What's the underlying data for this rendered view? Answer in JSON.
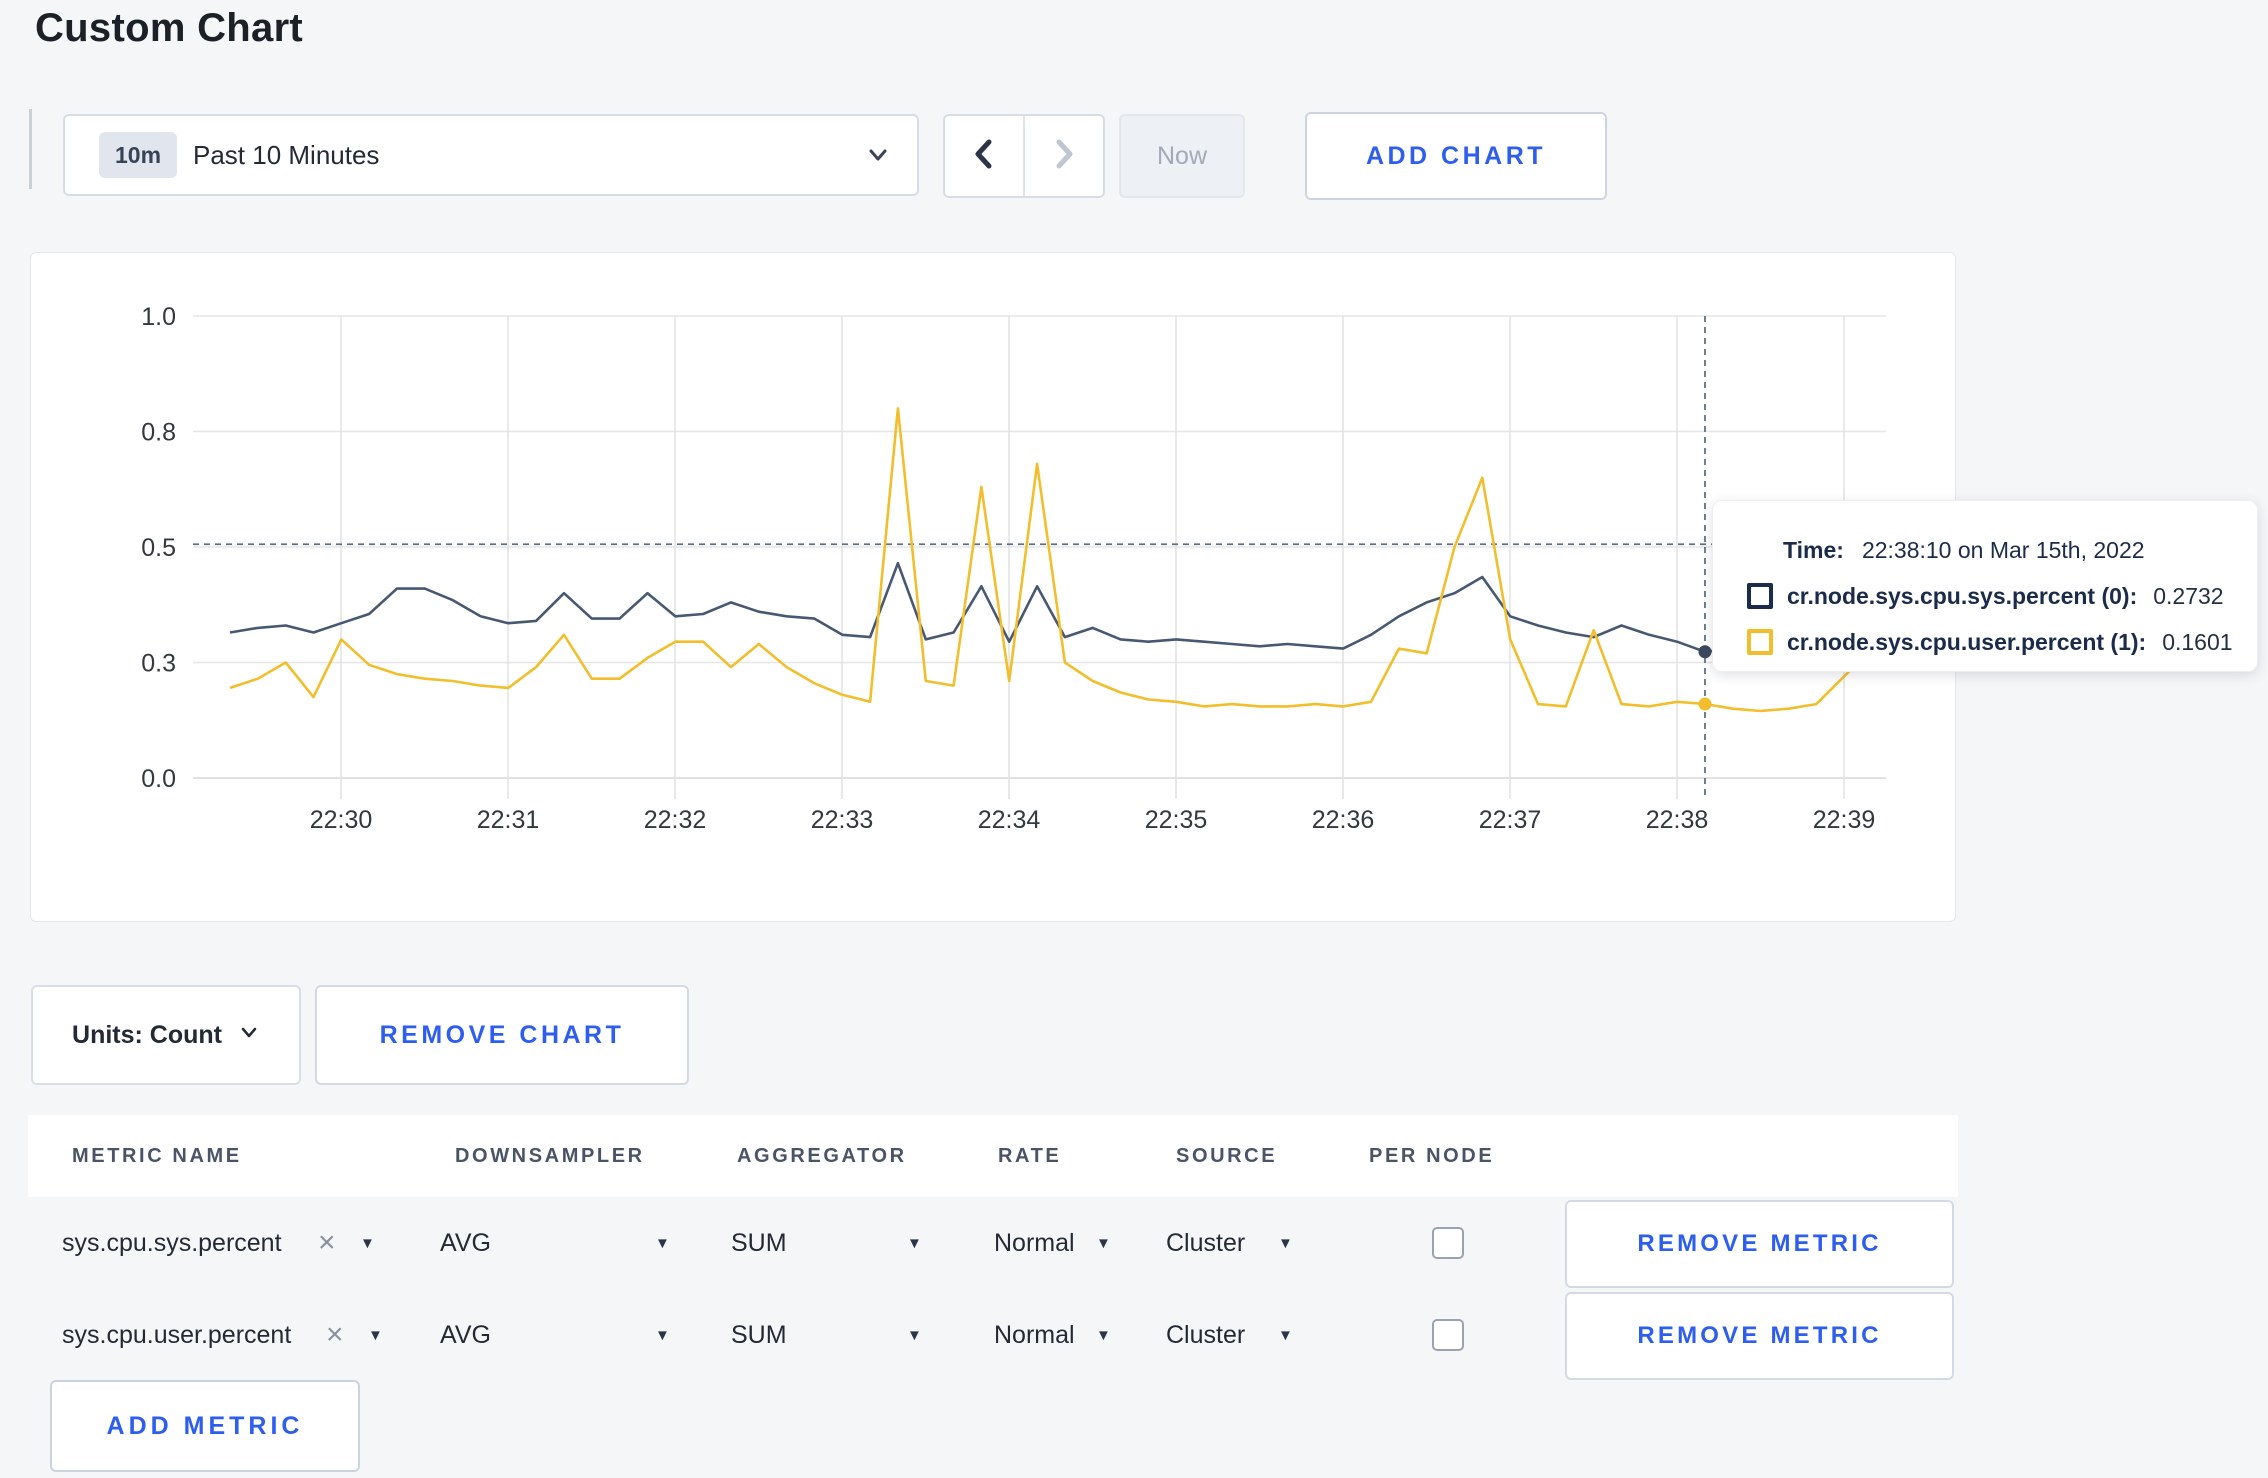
{
  "page": {
    "title": "Custom Chart",
    "background": "#f5f6f8",
    "accent_blue": "#2e5ef0"
  },
  "toolbar": {
    "time_select": {
      "badge": "10m",
      "label": "Past 10 Minutes"
    },
    "now_button": "Now",
    "add_chart_button": "ADD CHART"
  },
  "chart_data": {
    "type": "line",
    "title": "",
    "xlabel": "",
    "ylabel": "",
    "y_range": [
      0,
      1
    ],
    "grid": true,
    "y_tick_labels_bottom_up": [
      "0.0",
      "0.3",
      "0.5",
      "0.8",
      "1.0"
    ],
    "x_tick_labels": [
      "22:30",
      "22:31",
      "22:32",
      "22:33",
      "22:34",
      "22:35",
      "22:36",
      "22:37",
      "22:38",
      "22:39"
    ],
    "start_time": "22:29:20",
    "interval_seconds": 10,
    "series": [
      {
        "name": "cr.node.sys.cpu.sys.percent",
        "color": "#475872",
        "values": [
          0.315,
          0.325,
          0.33,
          0.315,
          0.335,
          0.355,
          0.41,
          0.41,
          0.385,
          0.35,
          0.335,
          0.34,
          0.4,
          0.345,
          0.345,
          0.4,
          0.35,
          0.355,
          0.38,
          0.36,
          0.35,
          0.345,
          0.31,
          0.305,
          0.465,
          0.3,
          0.315,
          0.415,
          0.295,
          0.415,
          0.305,
          0.325,
          0.3,
          0.295,
          0.3,
          0.295,
          0.29,
          0.285,
          0.29,
          0.285,
          0.28,
          0.31,
          0.35,
          0.38,
          0.4,
          0.435,
          0.35,
          0.33,
          0.315,
          0.305,
          0.33,
          0.31,
          0.295,
          0.2732,
          0.28,
          0.29,
          0.3,
          0.305,
          0.3,
          0.31,
          0.305
        ]
      },
      {
        "name": "cr.node.sys.cpu.user.percent",
        "color": "#F2BE2C",
        "values": [
          0.195,
          0.215,
          0.25,
          0.175,
          0.3,
          0.245,
          0.225,
          0.215,
          0.21,
          0.2,
          0.195,
          0.24,
          0.31,
          0.215,
          0.215,
          0.26,
          0.295,
          0.295,
          0.24,
          0.29,
          0.24,
          0.205,
          0.18,
          0.165,
          0.8,
          0.21,
          0.2,
          0.63,
          0.21,
          0.68,
          0.25,
          0.21,
          0.185,
          0.17,
          0.165,
          0.155,
          0.16,
          0.155,
          0.155,
          0.16,
          0.155,
          0.165,
          0.28,
          0.27,
          0.5,
          0.65,
          0.3,
          0.16,
          0.155,
          0.32,
          0.16,
          0.155,
          0.165,
          0.1601,
          0.15,
          0.145,
          0.15,
          0.16,
          0.22,
          0.28,
          0.25
        ]
      }
    ],
    "crosshair": {
      "time": "22:38:10",
      "x_index": 53,
      "y_value": 0.506
    },
    "legend_position": "tooltip"
  },
  "tooltip": {
    "time_label": "Time:",
    "time_value": "22:38:10 on Mar 15th, 2022",
    "rows": [
      {
        "name": "cr.node.sys.cpu.sys.percent (0):",
        "value": "0.2732",
        "color": "#1b2b4a"
      },
      {
        "name": "cr.node.sys.cpu.user.percent (1):",
        "value": "0.1601",
        "color": "#F2BE2C"
      }
    ]
  },
  "chart_controls": {
    "units_button": "Units: Count",
    "remove_chart_button": "REMOVE CHART"
  },
  "metrics_table": {
    "headers": [
      "METRIC NAME",
      "DOWNSAMPLER",
      "AGGREGATOR",
      "RATE",
      "SOURCE",
      "PER NODE"
    ],
    "rows": [
      {
        "name": "sys.cpu.sys.percent",
        "downsampler": "AVG",
        "aggregator": "SUM",
        "rate": "Normal",
        "source": "Cluster",
        "per_node_checked": false,
        "remove_button": "REMOVE METRIC"
      },
      {
        "name": "sys.cpu.user.percent",
        "downsampler": "AVG",
        "aggregator": "SUM",
        "rate": "Normal",
        "source": "Cluster",
        "per_node_checked": false,
        "remove_button": "REMOVE METRIC"
      }
    ],
    "add_metric_button": "ADD METRIC"
  },
  "icons": {
    "caret_down": "▼",
    "remove_x": "×"
  }
}
